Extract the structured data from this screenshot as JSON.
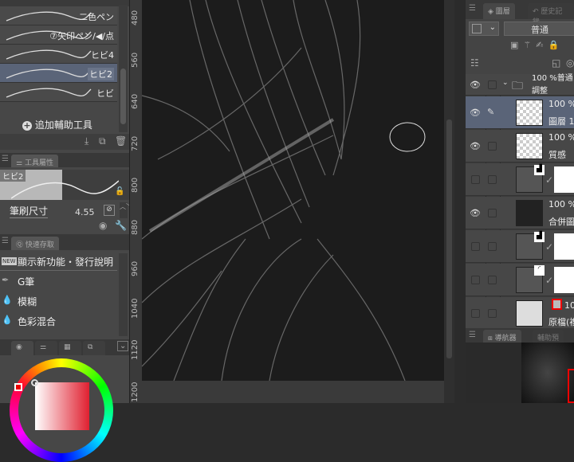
{
  "brushes": [
    {
      "label": "二色ペン"
    },
    {
      "label": "⑦矢印ペン/◀/点"
    },
    {
      "label": "ヒビ4"
    },
    {
      "label": "ヒビ2",
      "selected": true
    },
    {
      "label": "ヒビ"
    }
  ],
  "add_tool": "追加輔助工具",
  "tool_property": {
    "tab": "工具屬性",
    "preview_label": "ヒビ2",
    "size_label": "筆刷尺寸",
    "size_value": "4.55"
  },
  "quick_access": {
    "tab": "快速存取",
    "items": [
      "顯示新功能・發行說明",
      "G筆",
      "模糊",
      "色彩混合"
    ],
    "new_badge": "NEW"
  },
  "ruler": [
    "480",
    "560",
    "640",
    "720",
    "800",
    "880",
    "960",
    "1040",
    "1120",
    "1200"
  ],
  "layers_panel": {
    "tabs": [
      "圖層",
      "歷史記錄"
    ],
    "blend_mode": "普通",
    "layers": [
      {
        "line1": "100 %普通",
        "line2": "調整",
        "type": "folder",
        "visible": true
      },
      {
        "line1": "100 %",
        "line2": "圖層 1",
        "visible": true,
        "selected": true
      },
      {
        "line1": "100 %",
        "line2": "質感",
        "visible": true
      },
      {
        "type": "levels",
        "visible": false
      },
      {
        "line1": "100 %",
        "line2": "合併圖",
        "visible": true
      },
      {
        "type": "levels",
        "visible": false
      },
      {
        "type": "curves",
        "visible": false
      },
      {
        "line1": "10",
        "line2": "原檔(複",
        "visible": false
      }
    ]
  },
  "navigator": {
    "tabs": [
      "導航器",
      "輔助預"
    ]
  },
  "colors": {
    "accent": "#5a6478",
    "marker": "#e00000"
  }
}
